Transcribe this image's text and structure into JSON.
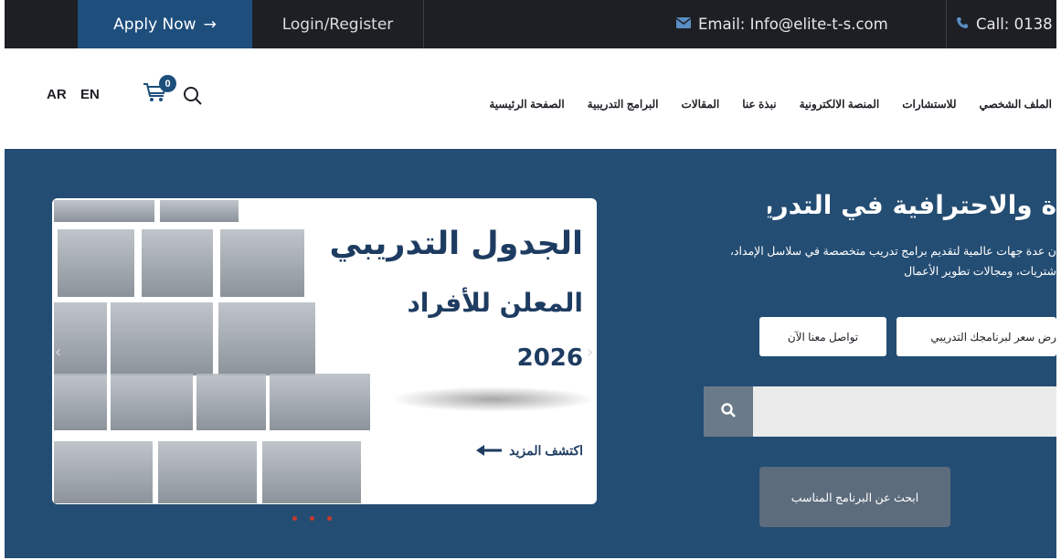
{
  "topbar": {
    "apply_label": "Apply Now",
    "apply_arrow": "→",
    "login_label": "Login/Register",
    "email_label": "Email: Info@elite-t-s.com",
    "call_label": "Call: 0138"
  },
  "header": {
    "lang_ar": "AR",
    "lang_en": "EN",
    "cart_count": "0",
    "nav": [
      {
        "label": "الصفحة الرئيسية"
      },
      {
        "label": "البرامج التدريبية"
      },
      {
        "label": "المقالات"
      },
      {
        "label": "نبذة عنا"
      },
      {
        "label": "المنصة الالكترونية"
      },
      {
        "label": "للاستشارات"
      },
      {
        "label": "الملف الشخصي"
      }
    ]
  },
  "slider": {
    "title": "الجدول التدريبي",
    "subtitle": "المعلن للأفراد",
    "year": "2026",
    "more_label": "اكتشف المزيد",
    "prev": "‹",
    "next": "›"
  },
  "hero": {
    "title": "ة والاحترافية في التدريب",
    "desc_line1": "ن عدة جهات عالمية لتقديم برامج تدريب متخصصة في سلاسل الإمداد،",
    "desc_line2": "شتريات، ومجالات تطوير الأعمال",
    "contact_label": "تواصل معنا الآن",
    "quote_label": "رض سعر لبرنامجك التدريبي",
    "find_label": "ابحث عن البرنامج المناسب"
  },
  "colors": {
    "topbar_bg": "#1d1f24",
    "accent": "#1e4e7c",
    "hero_bg": "#244d73",
    "dot": "#c73a2e"
  }
}
